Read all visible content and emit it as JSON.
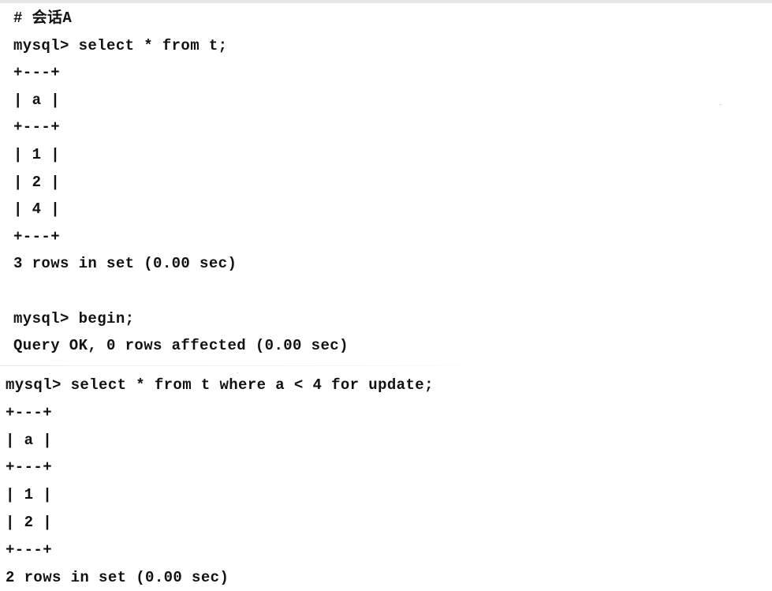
{
  "session_a": {
    "heading": "# 会话A",
    "lines": [
      "mysql> select * from t;",
      "+---+",
      "| a |",
      "+---+",
      "| 1 |",
      "| 2 |",
      "| 4 |",
      "+---+",
      "3 rows in set (0.00 sec)",
      "",
      "mysql> begin;",
      "Query OK, 0 rows affected (0.00 sec)"
    ]
  },
  "second_capture": {
    "lines": [
      "mysql> select * from t where a < 4 for update;",
      "+---+",
      "| a |",
      "+---+",
      "| 1 |",
      "| 2 |",
      "+---+",
      "2 rows in set (0.00 sec)"
    ]
  },
  "colors": {
    "text": "#111111",
    "background": "#ffffff"
  }
}
